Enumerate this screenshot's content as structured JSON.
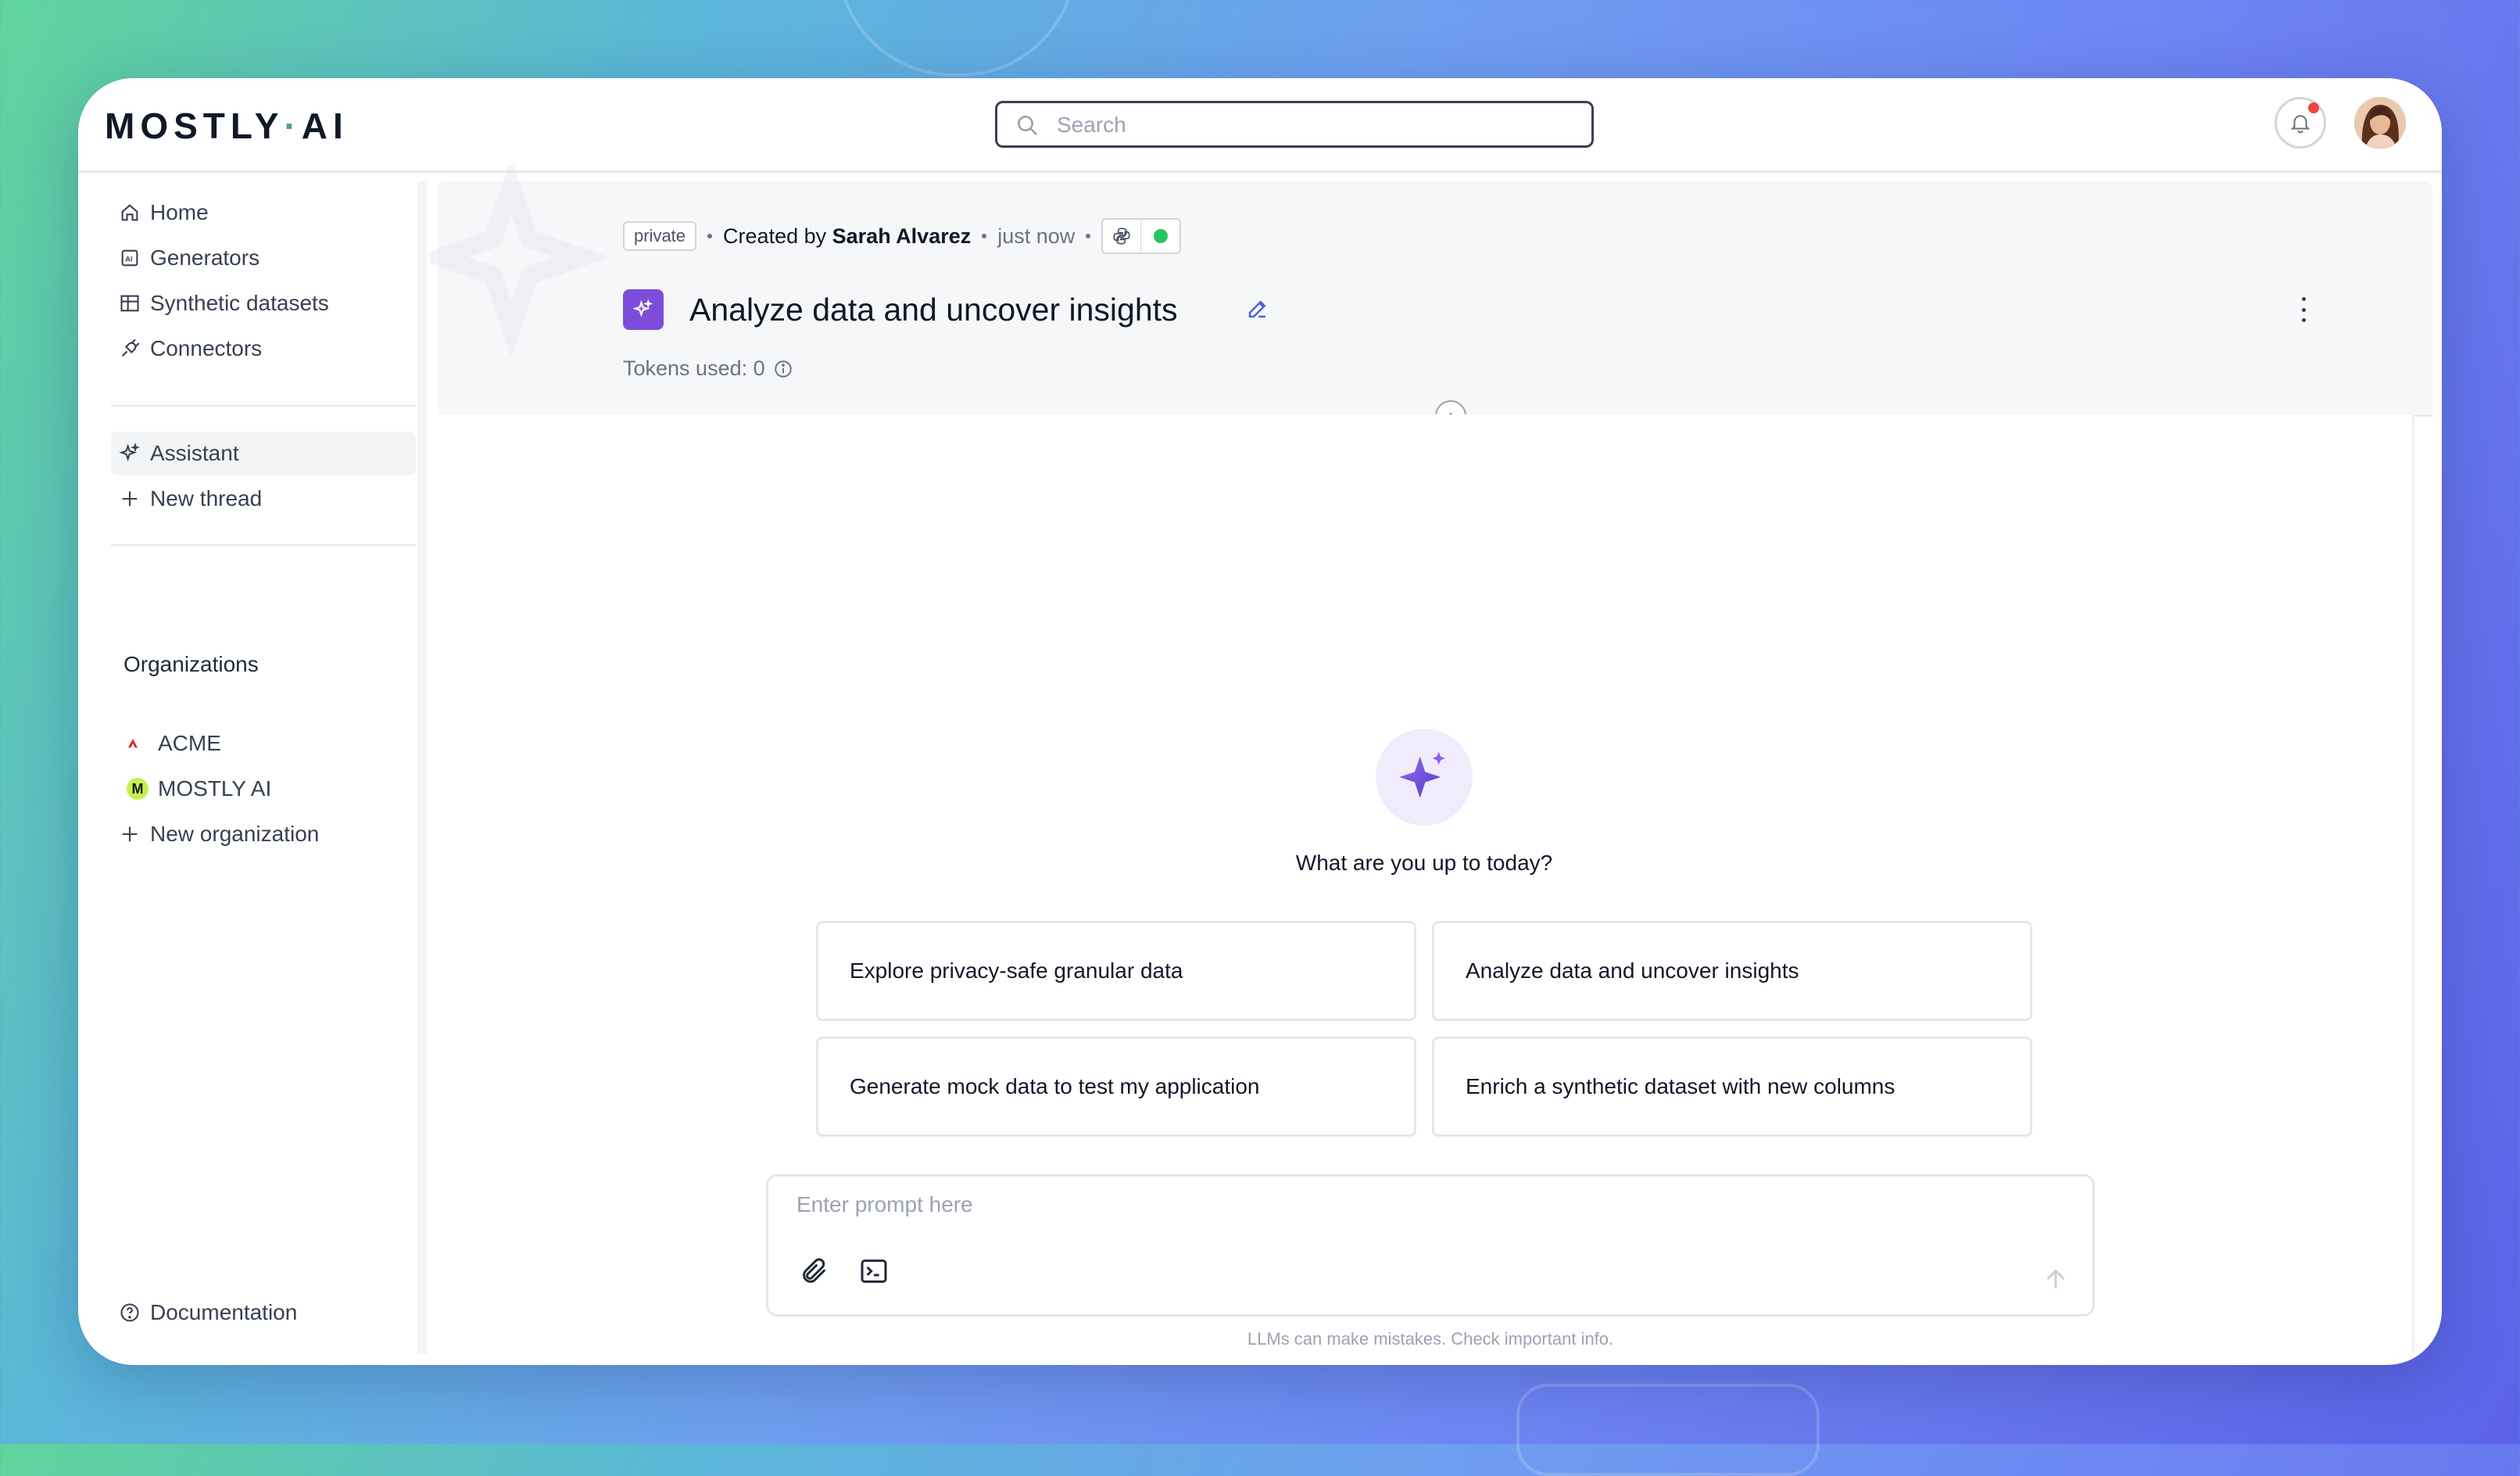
{
  "app": {
    "logo_left": "MOSTLY",
    "logo_dot": "·",
    "logo_right": "AI"
  },
  "search": {
    "placeholder": "Search",
    "value": ""
  },
  "sidebar": {
    "nav": [
      {
        "label": "Home",
        "icon": "home-icon"
      },
      {
        "label": "Generators",
        "icon": "generator-icon"
      },
      {
        "label": "Synthetic datasets",
        "icon": "table-icon"
      },
      {
        "label": "Connectors",
        "icon": "plug-icon"
      }
    ],
    "assistant": {
      "label": "Assistant",
      "icon": "sparkle-icon",
      "active": true
    },
    "new_thread": {
      "label": "New thread",
      "icon": "plus-icon"
    },
    "organizations_heading": "Organizations",
    "organizations": [
      {
        "label": "ACME",
        "icon": "acme-logo"
      },
      {
        "label": "MOSTLY AI",
        "icon": "mostly-ai-logo"
      }
    ],
    "new_organization": {
      "label": "New organization",
      "icon": "plus-icon"
    },
    "documentation": {
      "label": "Documentation",
      "icon": "help-circle-icon"
    }
  },
  "thread": {
    "visibility": "private",
    "created_by_prefix": "Created by",
    "author": "Sarah Alvarez",
    "time": "just now",
    "status_color": "#22c55e",
    "title": "Analyze data and uncover insights",
    "tokens_label": "Tokens used: 0"
  },
  "chat": {
    "greeting": "What are you up to today?",
    "suggestions": [
      "Explore privacy-safe granular data",
      "Analyze data and uncover insights",
      "Generate mock data to test my application",
      "Enrich a synthetic dataset with new columns"
    ],
    "prompt_placeholder": "Enter prompt here",
    "disclaimer": "LLMs can make mistakes. Check important info."
  },
  "colors": {
    "accent": "#7c4ddb",
    "notification": "#ef4444"
  }
}
